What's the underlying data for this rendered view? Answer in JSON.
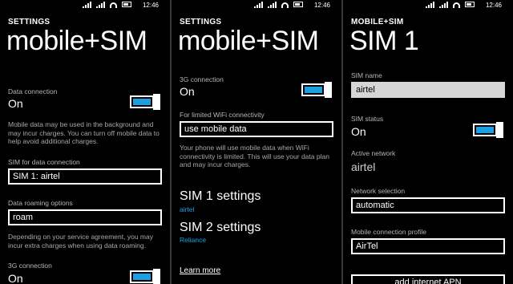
{
  "status": {
    "time": "12:46"
  },
  "panel1": {
    "app_title": "SETTINGS",
    "page_title": "mobile+SIM",
    "data_connection": {
      "label": "Data connection",
      "value": "On",
      "on": true
    },
    "data_desc": "Mobile data may be used in the background and may incur charges. You can turn off mobile data to help avoid additional charges.",
    "sim_for_data": {
      "label": "SIM for data connection",
      "value": "SIM 1: airtel"
    },
    "roaming": {
      "label": "Data roaming options",
      "value": "roam"
    },
    "roaming_desc": "Depending on your service agreement, you may incur extra charges when using data roaming.",
    "three_g": {
      "label": "3G connection",
      "value": "On",
      "on": true
    }
  },
  "panel2": {
    "app_title": "SETTINGS",
    "page_title": "mobile+SIM",
    "three_g": {
      "label": "3G connection",
      "value": "On",
      "on": true
    },
    "wifi_limited": {
      "label": "For limited WiFi connectivity",
      "value": "use mobile data"
    },
    "wifi_desc": "Your phone will use mobile data when WiFi connectivity is limited. This will use your data plan and may incur charges.",
    "sim1": {
      "title": "SIM 1 settings",
      "sub": "airtel"
    },
    "sim2": {
      "title": "SIM 2 settings",
      "sub": "Reliance"
    },
    "learn_more": "Learn more"
  },
  "panel3": {
    "app_title": "MOBILE+SIM",
    "page_title": "SIM 1",
    "sim_name": {
      "label": "SIM name",
      "value": "airtel"
    },
    "sim_status": {
      "label": "SIM status",
      "value": "On",
      "on": true
    },
    "active_network": {
      "label": "Active network",
      "value": "airtel"
    },
    "network_selection": {
      "label": "Network selection",
      "value": "automatic"
    },
    "connection_profile": {
      "label": "Mobile connection profile",
      "value": "AirTel"
    },
    "add_apn": "add internet APN"
  },
  "colors": {
    "accent": "#1ba1e2",
    "background": "#000000"
  }
}
